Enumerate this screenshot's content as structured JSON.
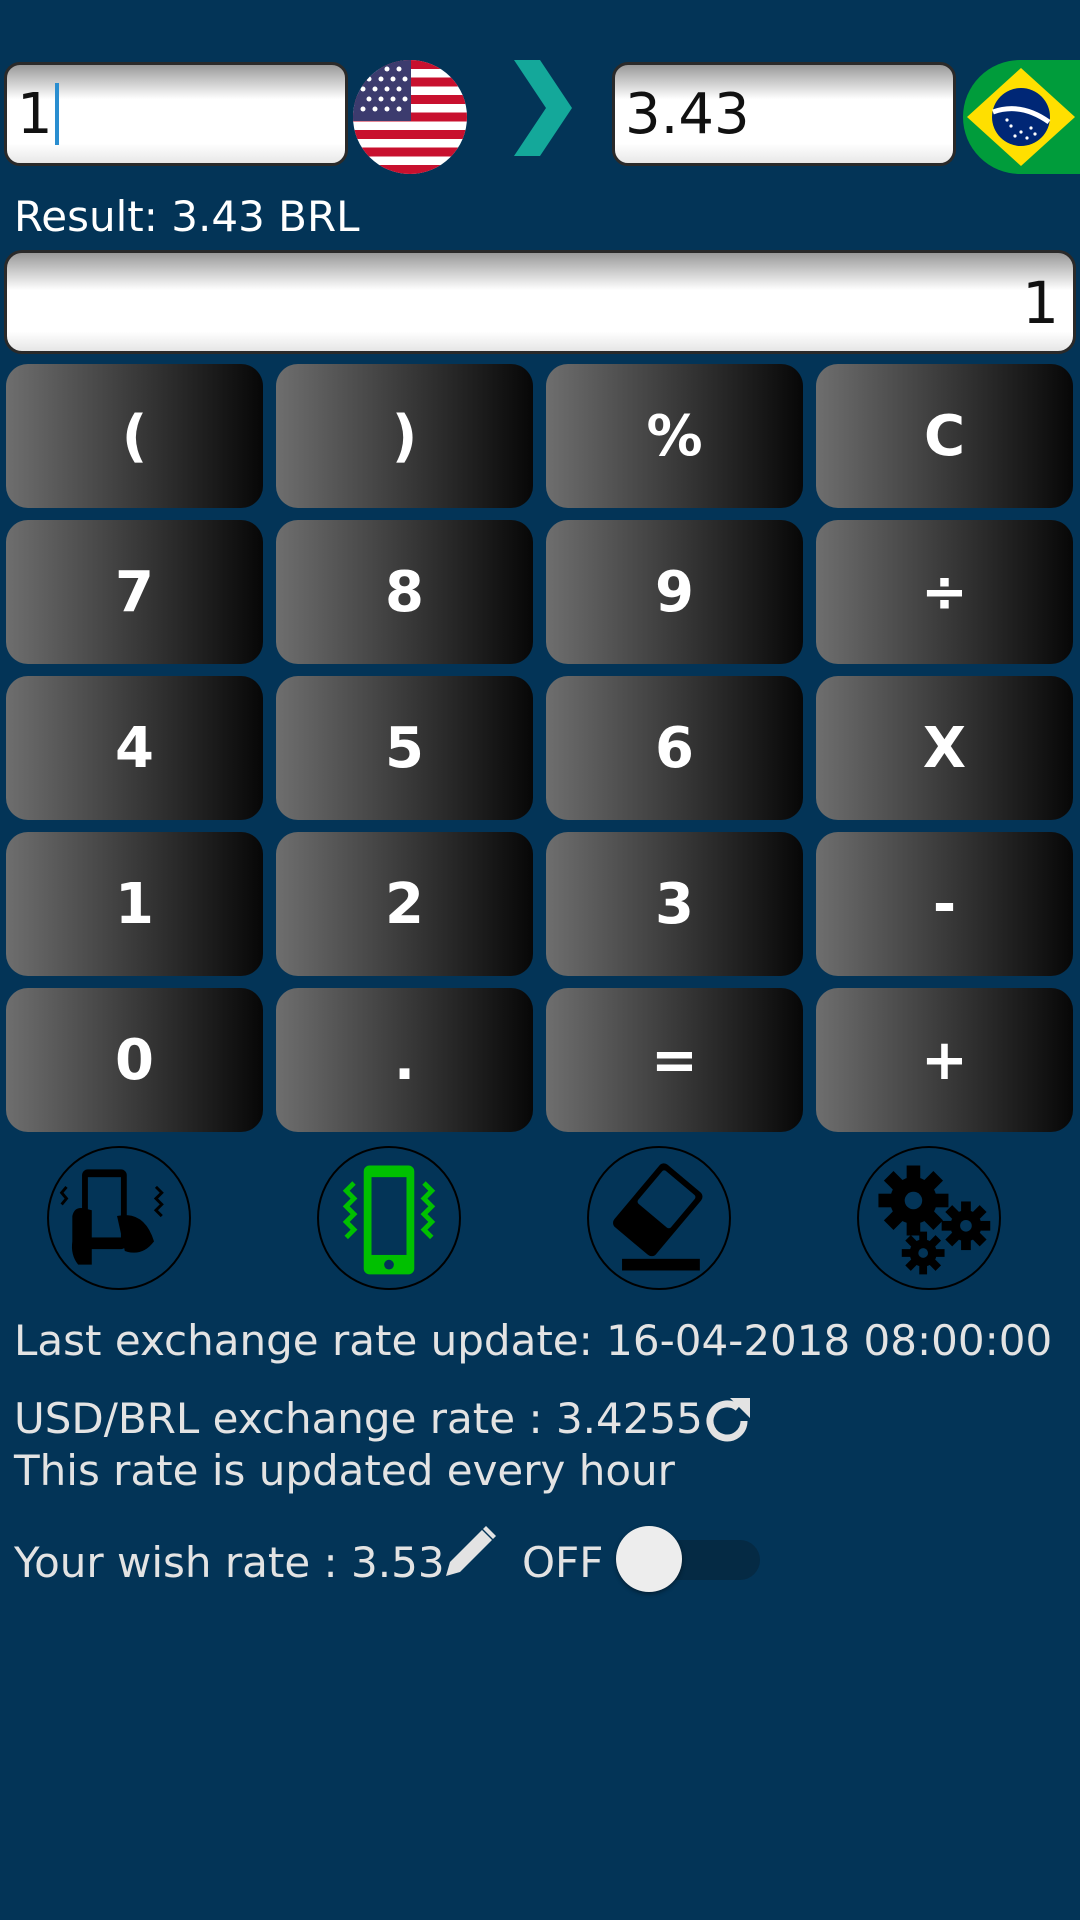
{
  "converter": {
    "from_value": "1",
    "to_value": "3.43",
    "from_currency_icon": "us-flag-icon",
    "to_currency_icon": "brazil-flag-icon",
    "arrow_icon": "chevron-right-icon",
    "arrow_color": "#14a89a"
  },
  "result": {
    "text": "Result: 3.43 BRL"
  },
  "expression": {
    "value": "1"
  },
  "keypad": {
    "keys": [
      "(",
      ")",
      "%",
      "C",
      "7",
      "8",
      "9",
      "÷",
      "4",
      "5",
      "6",
      "X",
      "1",
      "2",
      "3",
      "-",
      "0",
      ".",
      "=",
      "+"
    ]
  },
  "tools": [
    {
      "icon": "shake-phone-icon"
    },
    {
      "icon": "vibrate-phone-icon",
      "color": "#00c000"
    },
    {
      "icon": "eraser-icon"
    },
    {
      "icon": "settings-gears-icon"
    }
  ],
  "info": {
    "last_update": "Last exchange rate update: 16-04-2018 08:00:00",
    "rate": "USD/BRL exchange rate : 3.4255",
    "rate_note": "This rate is updated every hour",
    "wish_rate": "Your wish rate : 3.53",
    "toggle_label": "OFF",
    "toggle_on": false
  },
  "colors": {
    "background": "#033457"
  }
}
